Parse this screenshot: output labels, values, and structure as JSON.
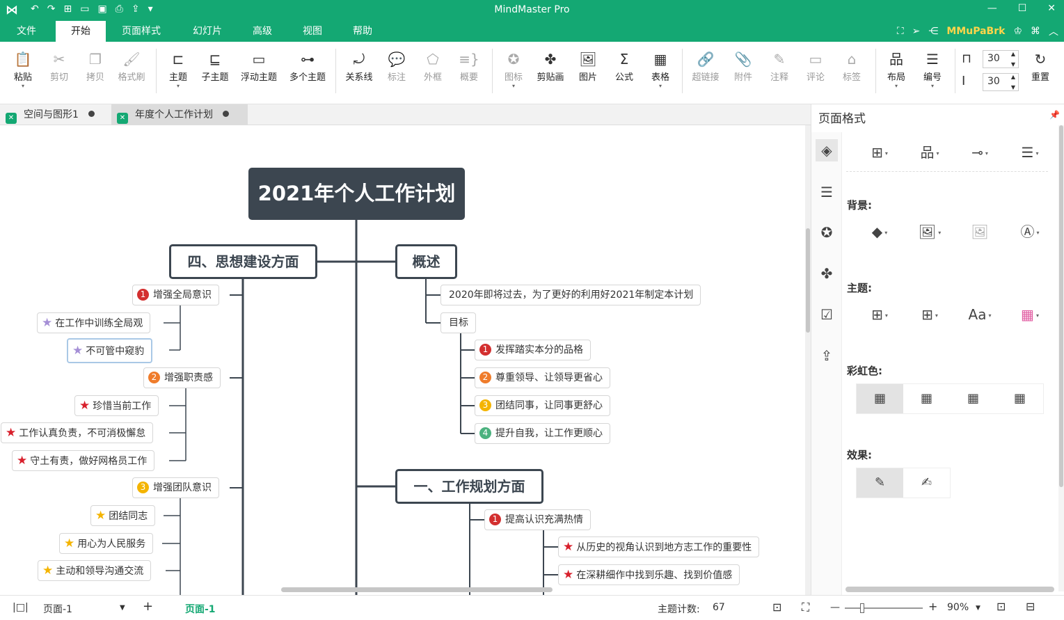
{
  "app": {
    "title": "MindMaster Pro",
    "user": "MMuPaBrk",
    "accent": "#14a873"
  },
  "menu": {
    "tabs": [
      "文件",
      "开始",
      "页面样式",
      "幻灯片",
      "高级",
      "视图",
      "帮助"
    ],
    "active": "开始"
  },
  "ribbon": {
    "paste": "粘贴",
    "cut": "剪切",
    "copy": "拷贝",
    "format_painter": "格式刷",
    "topic": "主题",
    "subtopic": "子主题",
    "floating": "浮动主题",
    "multiple": "多个主题",
    "relation": "关系线",
    "callout": "标注",
    "boundary": "外框",
    "summary": "概要",
    "icon": "图标",
    "clipart": "剪贴画",
    "picture": "图片",
    "formula": "公式",
    "table": "表格",
    "hyperlink": "超链接",
    "attachment": "附件",
    "note": "注释",
    "comment": "评论",
    "tag": "标签",
    "layout": "布局",
    "numbering": "编号",
    "spacing_h": "30",
    "spacing_v": "30",
    "reset": "重置"
  },
  "doc_tabs": [
    "空间与图形1",
    "年度个人工作计划"
  ],
  "mindmap": {
    "root": "2021年个人工作计划",
    "left_main": "四、思想建设方面",
    "left_items": [
      {
        "num": "1",
        "label": "增强全局意识"
      },
      {
        "label": "在工作中训练全局观"
      },
      {
        "label": "不可管中窥豹"
      },
      {
        "num": "2",
        "label": "增强职责感"
      },
      {
        "label": "珍惜当前工作"
      },
      {
        "label": "工作认真负责，不可消极懈怠"
      },
      {
        "label": "守土有责，做好网格员工作"
      },
      {
        "num": "3",
        "label": "增强团队意识"
      },
      {
        "label": "团结同志"
      },
      {
        "label": "用心为人民服务"
      },
      {
        "label": "主动和领导沟通交流"
      }
    ],
    "overview": "概述",
    "overview_items": [
      {
        "label": "2020年即将过去，为了更好的利用好2021年制定本计划"
      },
      {
        "label": "目标"
      },
      {
        "num": "1",
        "label": "发挥踏实本分的品格"
      },
      {
        "num": "2",
        "label": "尊重领导、让领导更省心"
      },
      {
        "num": "3",
        "label": "团结同事，让同事更舒心"
      },
      {
        "num": "4",
        "label": "提升自我，让工作更顺心"
      }
    ],
    "right_main": "一、工作规划方面",
    "right_items": [
      {
        "num": "1",
        "label": "提高认识充满热情"
      },
      {
        "label": "从历史的视角认识到地方志工作的重要性"
      },
      {
        "label": "在深耕细作中找到乐趣、找到价值感"
      }
    ],
    "colors": {
      "num1": "#d32f2f",
      "num2": "#ef7c2b",
      "num3": "#f4b400",
      "num4": "#4cb27f",
      "star_purple": "#a58fd6",
      "star_red": "#d8202c",
      "star_gold": "#f4b400"
    }
  },
  "panel": {
    "title": "页面格式",
    "background": "背景:",
    "theme": "主题:",
    "rainbow": "彩虹色:",
    "effect": "效果:"
  },
  "status": {
    "page_select": "页面-1",
    "page_tab": "页面-1",
    "topic_count_label": "主题计数:",
    "topic_count": "67",
    "zoom": "90%"
  }
}
